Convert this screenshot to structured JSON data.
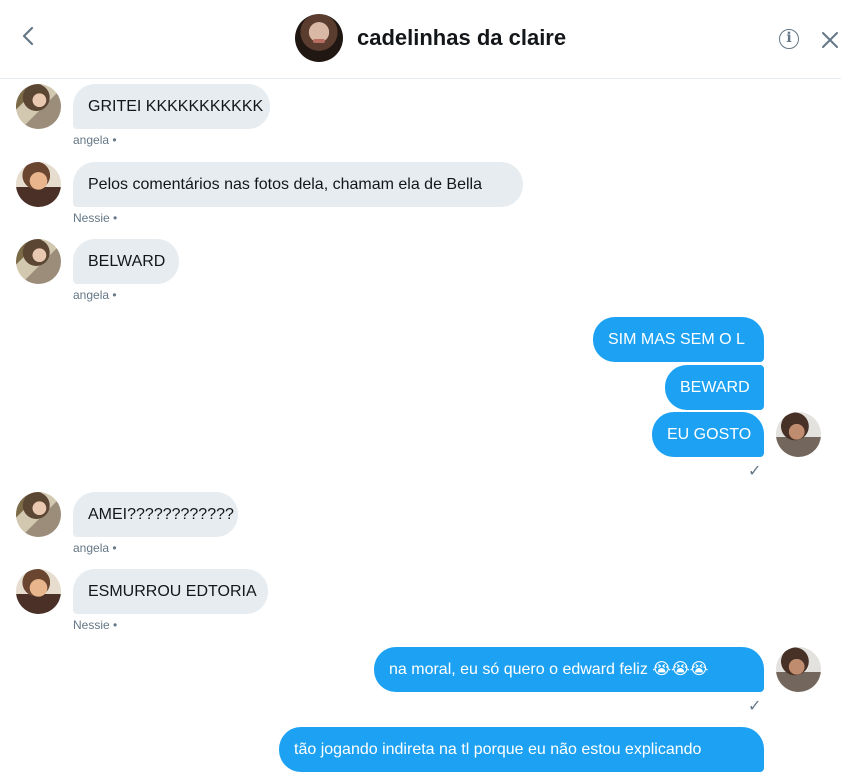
{
  "header": {
    "title": "cadelinhas da claire",
    "back_icon": "chevron-left-icon",
    "info_icon": "info-icon",
    "close_icon": "close-icon"
  },
  "messages": [
    {
      "sender": "angela",
      "text": "GRITEI KKKKKKKKKKK",
      "meta": "angela •"
    },
    {
      "sender": "Nessie",
      "text": "Pelos comentários nas fotos dela, chamam ela de Bella",
      "meta": "Nessie •"
    },
    {
      "sender": "angela",
      "text": "BELWARD",
      "meta": "angela •"
    },
    {
      "sender": "me",
      "text": "SIM MAS SEM O L"
    },
    {
      "sender": "me",
      "text": "BEWARD"
    },
    {
      "sender": "me",
      "text": "EU GOSTO",
      "status": "✓"
    },
    {
      "sender": "angela",
      "text": "AMEI????????????",
      "meta": "angela •"
    },
    {
      "sender": "Nessie",
      "text": "ESMURROU EDTORIA",
      "meta": "Nessie •"
    },
    {
      "sender": "me",
      "text": "na moral, eu só quero o edward feliz",
      "emoji": "😭😭😭",
      "status": "✓"
    },
    {
      "sender": "me",
      "text": "tão jogando indireta na tl porque eu não estou explicando"
    }
  ],
  "colors": {
    "incoming_bubble": "#e6ecf0",
    "outgoing_bubble": "#1da1f2",
    "meta": "#657786"
  }
}
